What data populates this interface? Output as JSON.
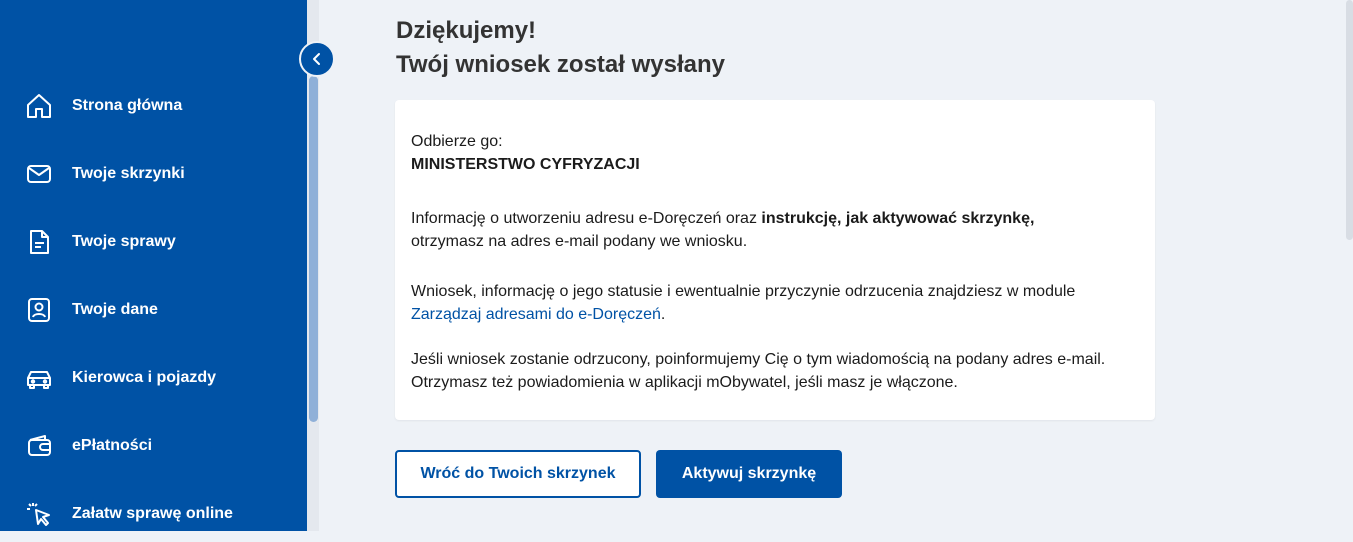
{
  "sidebar": {
    "items": [
      {
        "label": "Strona główna",
        "icon": "home-icon"
      },
      {
        "label": "Twoje skrzynki",
        "icon": "envelope-icon"
      },
      {
        "label": "Twoje sprawy",
        "icon": "document-icon"
      },
      {
        "label": "Twoje dane",
        "icon": "id-card-icon"
      },
      {
        "label": "Kierowca i pojazdy",
        "icon": "car-icon"
      },
      {
        "label": "ePłatności",
        "icon": "wallet-icon"
      },
      {
        "label": "Załatw sprawę online",
        "icon": "pointer-click-icon"
      }
    ]
  },
  "main": {
    "title_line1": "Dziękujemy!",
    "title_line2": "Twój wniosek został wysłany",
    "card": {
      "receiver_label": "Odbierze go:",
      "receiver_value": "MINISTERSTWO CYFRYZACJI",
      "p1_text_a": "Informację o utworzeniu adresu e-Doręczeń oraz ",
      "p1_bold": "instrukcję, jak aktywować skrzynkę,",
      "p1_text_b": "otrzymasz na adres e-mail podany we wniosku.",
      "p2_text": "Wniosek, informację o jego statusie i ewentualnie przyczynie odrzucenia znajdziesz w module",
      "p2_link": "Zarządzaj adresami do e-Doręczeń",
      "p2_after": ".",
      "p3_line1": "Jeśli wniosek zostanie odrzucony, poinformujemy Cię o tym wiadomością na podany adres e-mail.",
      "p3_line2": "Otrzymasz też powiadomienia w aplikacji mObywatel, jeśli masz je włączone."
    },
    "buttons": {
      "back": "Wróć do Twoich skrzynek",
      "activate": "Aktywuj skrzynkę"
    }
  },
  "colors": {
    "brand": "#0052a5",
    "background": "#eef2f7"
  }
}
